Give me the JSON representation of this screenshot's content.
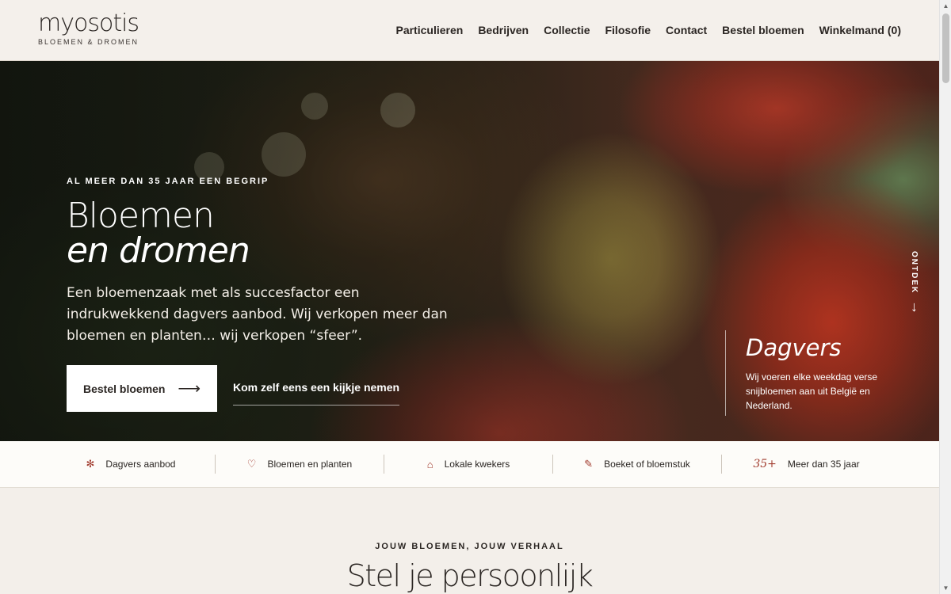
{
  "header": {
    "logo": "myosotis",
    "logo_sub": "BLOEMEN & DROMEN",
    "nav": [
      "Particulieren",
      "Bedrijven",
      "Collectie",
      "Filosofie",
      "Contact",
      "Bestel bloemen",
      "Winkelmand (0)"
    ]
  },
  "hero": {
    "eyebrow": "AL MEER DAN 35 JAAR EEN BEGRIP",
    "title_line1": "Bloemen",
    "title_line2": "en dromen",
    "intro": "Een bloemenzaak met als succesfactor een indrukwekkend dagvers aanbod. Wij verkopen meer dan bloemen en planten… wij verkopen “sfeer”.",
    "cta_primary": "Bestel bloemen",
    "cta_arrow": "⟶",
    "cta_secondary": "Kom zelf eens een kijkje nemen",
    "side_label": "ONTDEK",
    "side_arrow": "↓",
    "card_title": "Dagvers",
    "card_text": "Wij voeren elke weekdag verse snijbloemen aan uit België en Nederland."
  },
  "features": [
    {
      "icon": "asterisk-icon",
      "glyph": "✻",
      "label": "Dagvers aanbod"
    },
    {
      "icon": "heart-icon",
      "glyph": "♡",
      "label": "Bloemen en planten"
    },
    {
      "icon": "house-icon",
      "glyph": "⌂",
      "label": "Lokale kwekers"
    },
    {
      "icon": "pencil-icon",
      "glyph": "✎",
      "label": "Boeket of bloemstuk"
    },
    {
      "icon": "years-badge-icon",
      "glyph": "35+",
      "label": "Meer dan 35 jaar"
    }
  ],
  "section": {
    "eyebrow": "JOUW BLOEMEN, JOUW VERHAAL",
    "title": "Stel je persoonlijk"
  },
  "colors": {
    "accent": "#a13b2e",
    "background": "#f3efea",
    "text": "#2b2623"
  }
}
